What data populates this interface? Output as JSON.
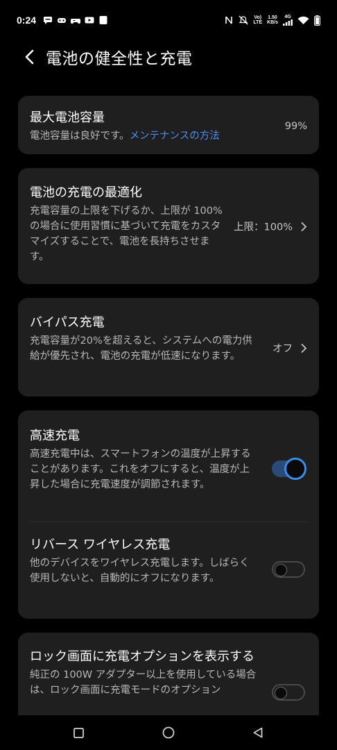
{
  "status_bar": {
    "time": "0:24",
    "volte_top": "Vo)",
    "volte_bottom": "LTE",
    "speed_top": "1.50",
    "speed_bottom": "KB/s",
    "network_type": "4G"
  },
  "header": {
    "title": "電池の健全性と充電"
  },
  "cards": {
    "capacity": {
      "title": "最大電池容量",
      "desc_text": "電池容量は良好です。",
      "desc_link": "メンテナンスの方法",
      "value": "99%"
    },
    "optimize": {
      "title": "電池の充電の最適化",
      "desc": "充電容量の上限を下げるか、上限が 100% の場合に使用習慣に基づいて充電をカスタマイズすることで、電池を長持ちさせます。",
      "value": "上限：100%"
    },
    "bypass": {
      "title": "バイパス充電",
      "desc": "充電容量が20%を超えると、システムへの電力供給が優先され、電池の充電が低速になります。",
      "value": "オフ"
    },
    "fast_charge": {
      "title": "高速充電",
      "desc": "高速充電中は、スマートフォンの温度が上昇することがあります。これをオフにすると、温度が上昇した場合に充電速度が調節されます。",
      "toggle_state": "on"
    },
    "reverse_wireless": {
      "title": "リバース ワイヤレス充電",
      "desc": "他のデバイスをワイヤレス充電します。しばらく使用しないと、自動的にオフになります。",
      "toggle_state": "off"
    },
    "lock_screen": {
      "title": "ロック画面に充電オプションを表示する",
      "desc": "純正の 100W アダプター以上を使用している場合は、ロック画面に充電モードのオプション",
      "toggle_state": "off"
    }
  },
  "colors": {
    "accent": "#3d8bf0",
    "link": "#4a8ff5",
    "card_bg": "#1f1f1f",
    "background": "#000000"
  }
}
